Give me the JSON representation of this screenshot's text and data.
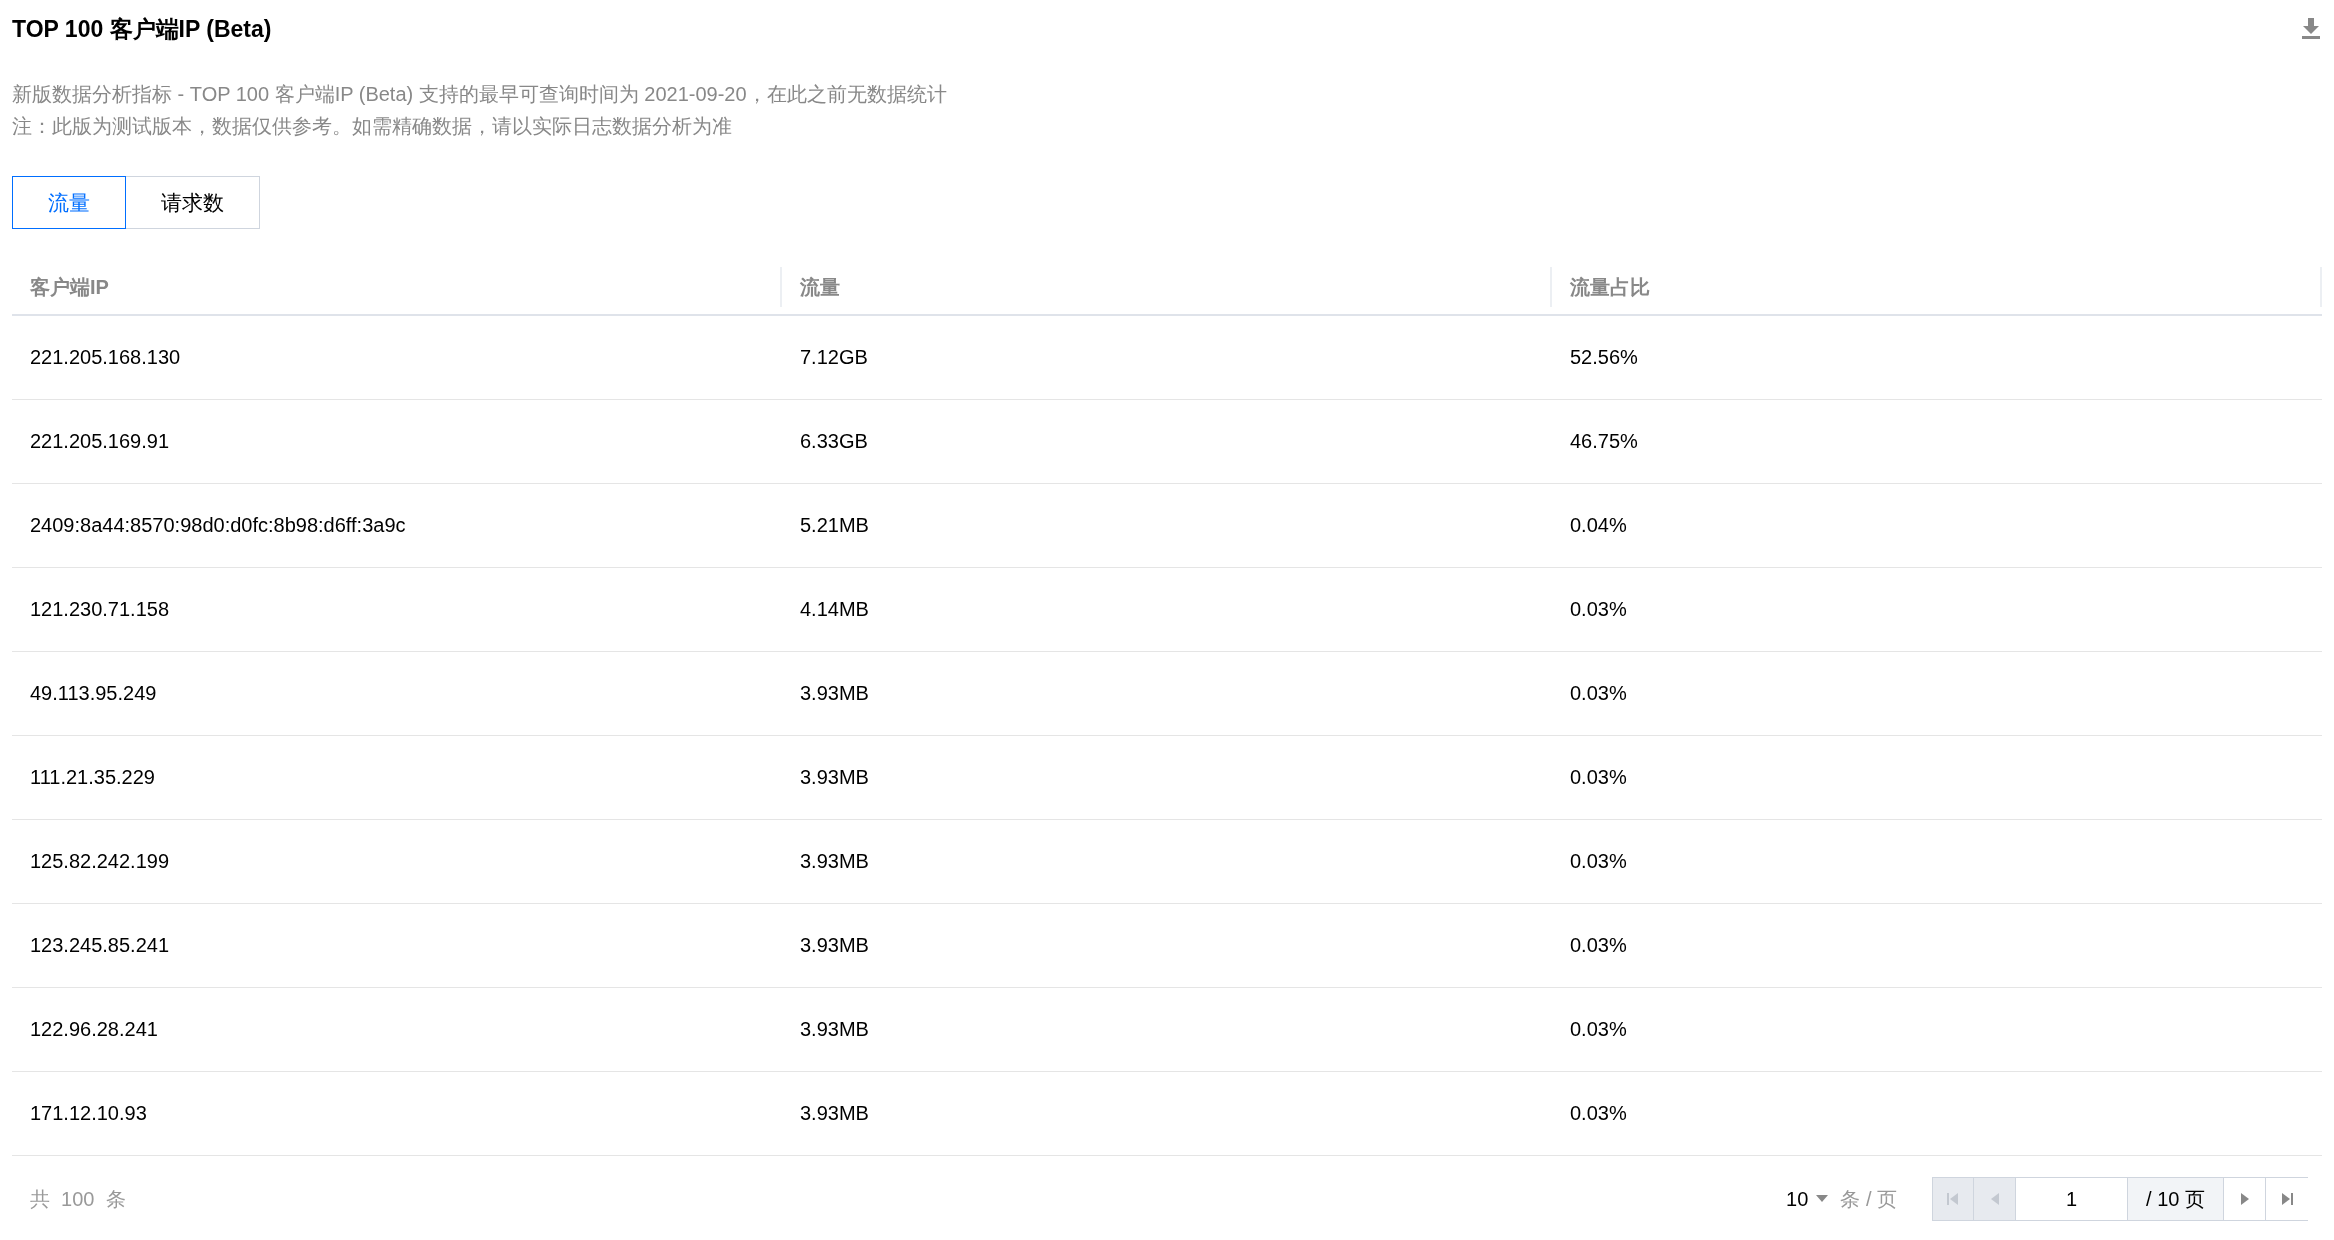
{
  "title": "TOP 100 客户端IP (Beta)",
  "notes": [
    "新版数据分析指标 - TOP 100 客户端IP (Beta) 支持的最早可查询时间为 2021-09-20，在此之前无数据统计",
    "注：此版为测试版本，数据仅供参考。如需精确数据，请以实际日志数据分析为准"
  ],
  "tabs": [
    {
      "label": "流量",
      "selected": true
    },
    {
      "label": "请求数",
      "selected": false
    }
  ],
  "table": {
    "columns": [
      "客户端IP",
      "流量",
      "流量占比"
    ],
    "rows": [
      [
        "221.205.168.130",
        "7.12GB",
        "52.56%"
      ],
      [
        "221.205.169.91",
        "6.33GB",
        "46.75%"
      ],
      [
        "2409:8a44:8570:98d0:d0fc:8b98:d6ff:3a9c",
        "5.21MB",
        "0.04%"
      ],
      [
        "121.230.71.158",
        "4.14MB",
        "0.03%"
      ],
      [
        "49.113.95.249",
        "3.93MB",
        "0.03%"
      ],
      [
        "111.21.35.229",
        "3.93MB",
        "0.03%"
      ],
      [
        "125.82.242.199",
        "3.93MB",
        "0.03%"
      ],
      [
        "123.245.85.241",
        "3.93MB",
        "0.03%"
      ],
      [
        "122.96.28.241",
        "3.93MB",
        "0.03%"
      ],
      [
        "171.12.10.93",
        "3.93MB",
        "0.03%"
      ]
    ]
  },
  "pagination": {
    "total": "共  100  条",
    "page_size": "10",
    "page_size_unit": "条 / 页",
    "page": "1",
    "page_count": "/ 10 页",
    "buttons": [
      {
        "kind": "first",
        "disabled": true
      },
      {
        "kind": "prev",
        "disabled": true
      },
      {
        "kind": "next",
        "disabled": false
      },
      {
        "kind": "last",
        "disabled": false
      }
    ]
  }
}
